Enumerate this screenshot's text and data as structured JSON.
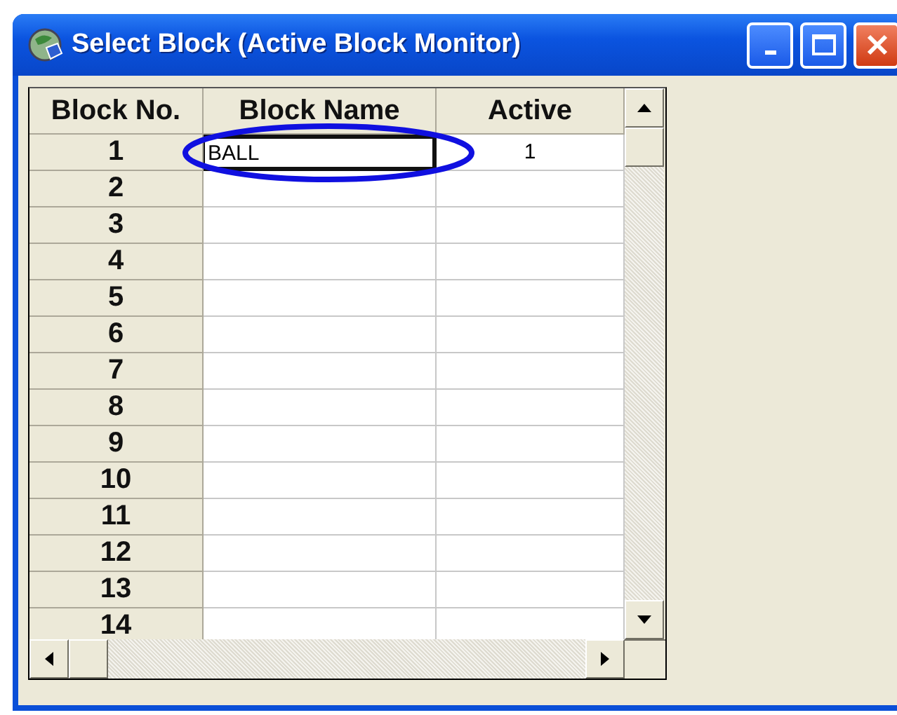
{
  "window": {
    "title": "Select Block (Active Block Monitor)"
  },
  "table": {
    "columns": [
      "Block No.",
      "Block Name",
      "Active"
    ],
    "rows": [
      {
        "number": "1",
        "name": "BALL",
        "active": "1",
        "editing": true
      },
      {
        "number": "2",
        "editing": false
      },
      {
        "number": "3",
        "editing": false
      },
      {
        "number": "4",
        "editing": false
      },
      {
        "number": "5",
        "editing": false
      },
      {
        "number": "6",
        "editing": false
      },
      {
        "number": "7",
        "editing": false
      },
      {
        "number": "8",
        "editing": false
      },
      {
        "number": "9",
        "editing": false
      },
      {
        "number": "10",
        "editing": false
      },
      {
        "number": "11",
        "editing": false
      },
      {
        "number": "12",
        "editing": false
      },
      {
        "number": "13",
        "editing": false
      },
      {
        "number": "14",
        "editing": false
      }
    ]
  }
}
